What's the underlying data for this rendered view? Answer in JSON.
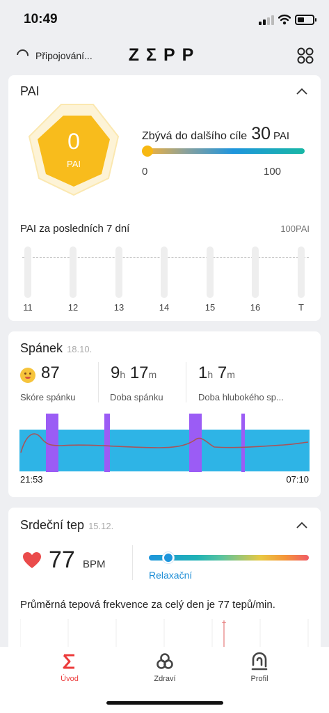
{
  "status_bar": {
    "time": "10:49"
  },
  "header": {
    "connecting_text": "Připojování...",
    "logo": "ZΣPP"
  },
  "pai": {
    "title": "PAI",
    "value": "0",
    "value_label": "PAI",
    "remaining_text": "Zbývá do dalšího cíle",
    "remaining_value": "30",
    "remaining_unit": "PAI",
    "bar_min": "0",
    "bar_max": "100",
    "bar_fraction": 0,
    "week_title": "PAI za posledních 7 dní",
    "week_max_label": "100PAI",
    "week_days": [
      "11",
      "12",
      "13",
      "14",
      "15",
      "16",
      "T"
    ],
    "week_values": [
      0,
      0,
      0,
      0,
      0,
      0,
      0
    ]
  },
  "sleep": {
    "title": "Spánek",
    "date": "18.10.",
    "score": "87",
    "score_label": "Skóre spánku",
    "duration_hours": "9",
    "duration_minutes": "17",
    "duration_label": "Doba spánku",
    "deep_hours": "1",
    "deep_minutes": "7",
    "deep_label": "Doba hlubokého sp...",
    "unit_h": "h",
    "unit_m": "m",
    "start_time": "21:53",
    "end_time": "07:10"
  },
  "heart": {
    "title": "Srdeční tep",
    "date": "15.12.",
    "value": "77",
    "unit": "BPM",
    "zone": "Relaxační",
    "zone_fraction": 0.12,
    "average_text": "Průměrná tepová frekvence za celý den je 77 tepů/min."
  },
  "nav": {
    "items": [
      {
        "label": "Úvod",
        "active": true
      },
      {
        "label": "Zdraví",
        "active": false
      },
      {
        "label": "Profil",
        "active": false
      }
    ]
  },
  "colors": {
    "pai_hex": "#f8bc1c",
    "sleep_light": "#2eb4e6",
    "sleep_awake": "#9b5cf5",
    "active_nav": "#ec3b3b"
  }
}
